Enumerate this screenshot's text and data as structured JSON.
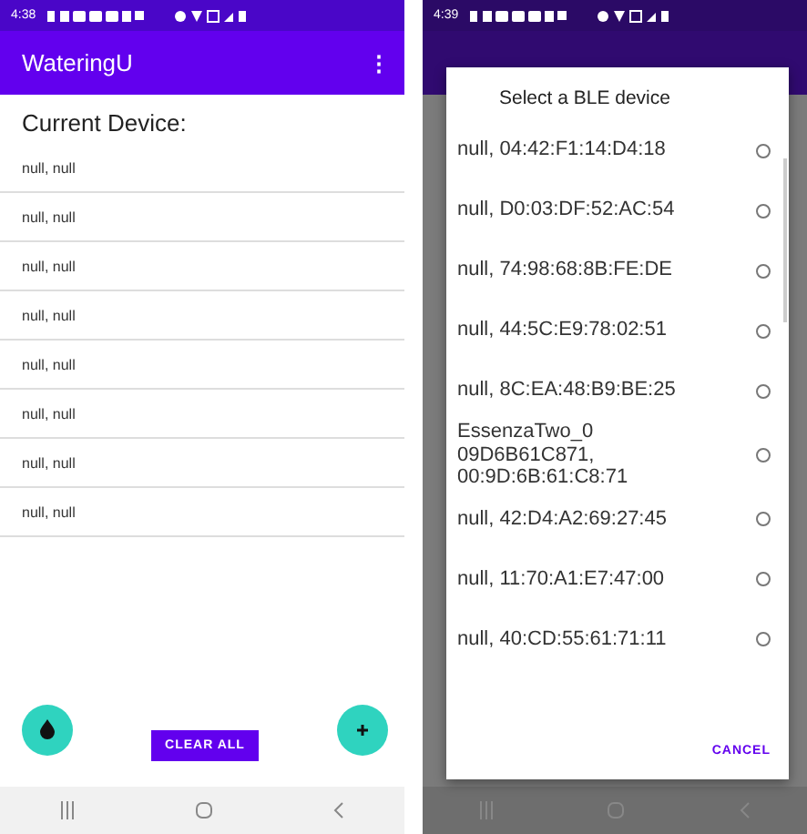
{
  "main_screen": {
    "status_bar": {
      "time": "4:38"
    },
    "app_bar": {
      "title": "WateringU",
      "menu_icon": "⋮"
    },
    "heading": "Current Device:",
    "devices": [
      "null, null",
      "null, null",
      "null, null",
      "null, null",
      "null, null",
      "null, null",
      "null, null",
      "null, null"
    ],
    "clear_button": "CLEAR ALL"
  },
  "dialog_screen": {
    "status_bar": {
      "time": "4:39"
    },
    "dialog": {
      "title": "Select a BLE device",
      "devices": [
        {
          "name": "null, 04:42:F1:14:D4:18",
          "selected": false
        },
        {
          "name": "null, D0:03:DF:52:AC:54",
          "selected": false
        },
        {
          "name": "null, 74:98:68:8B:FE:DE",
          "selected": false
        },
        {
          "name": "null, 44:5C:E9:78:02:51",
          "selected": false
        },
        {
          "name": "null, 8C:EA:48:B9:BE:25",
          "selected": false
        },
        {
          "name": "EssenzaTwo_0 09D6B61C871, 00:9D:6B:61:C8:71",
          "selected": false
        },
        {
          "name": "null, 42:D4:A2:69:27:45",
          "selected": false
        },
        {
          "name": "null, 11:70:A1:E7:47:00",
          "selected": false
        },
        {
          "name": "null, 40:CD:55:61:71:11",
          "selected": false
        }
      ],
      "cancel_button": "CANCEL"
    }
  }
}
